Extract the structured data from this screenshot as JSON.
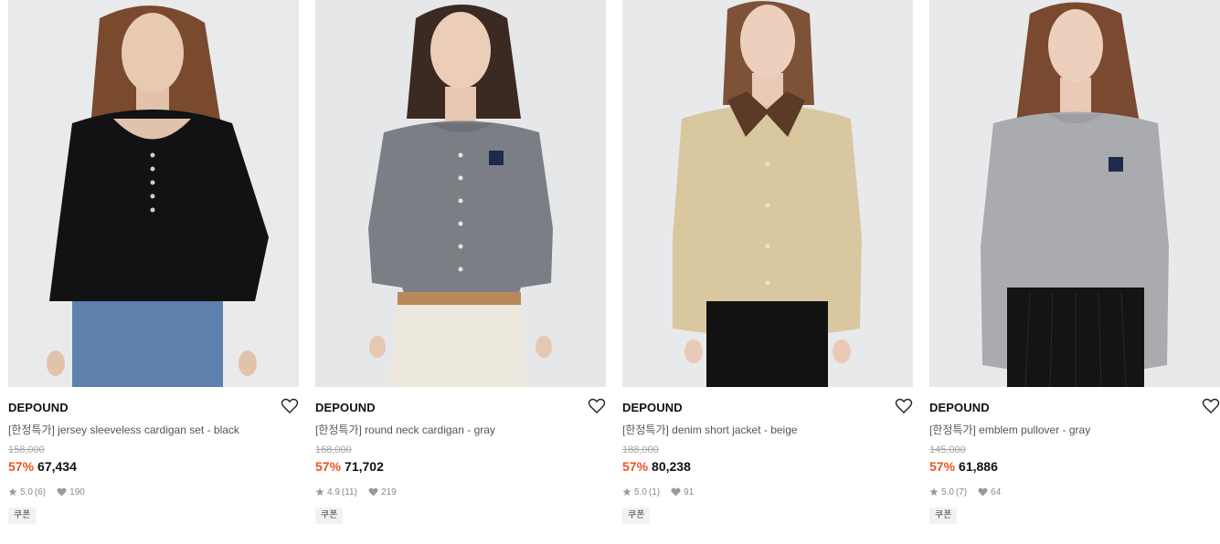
{
  "products": [
    {
      "brand": "DEPOUND",
      "name": "[한정특가] jersey sleeveless cardigan set - black",
      "original_price": "158,000",
      "discount": "57%",
      "sale_price": "67,434",
      "rating": "5.0",
      "reviews": "(6)",
      "likes": "190",
      "coupon": "쿠폰"
    },
    {
      "brand": "DEPOUND",
      "name": "[한정특가] round neck cardigan - gray",
      "original_price": "168,000",
      "discount": "57%",
      "sale_price": "71,702",
      "rating": "4.9",
      "reviews": "(11)",
      "likes": "219",
      "coupon": "쿠폰"
    },
    {
      "brand": "DEPOUND",
      "name": "[한정특가] denim short jacket - beige",
      "original_price": "188,000",
      "discount": "57%",
      "sale_price": "80,238",
      "rating": "5.0",
      "reviews": "(1)",
      "likes": "91",
      "coupon": "쿠폰"
    },
    {
      "brand": "DEPOUND",
      "name": "[한정특가] emblem pullover - gray",
      "original_price": "145,000",
      "discount": "57%",
      "sale_price": "61,886",
      "rating": "5.0",
      "reviews": "(7)",
      "likes": "64",
      "coupon": "쿠폰"
    }
  ],
  "colors": {
    "discount": "#f0521f",
    "muted_text": "#8a8a8a",
    "strike_price": "#a5a5a5"
  },
  "icons": {
    "wishlist": "heart-outline-icon",
    "rating": "star-icon",
    "likes": "heart-filled-icon"
  }
}
